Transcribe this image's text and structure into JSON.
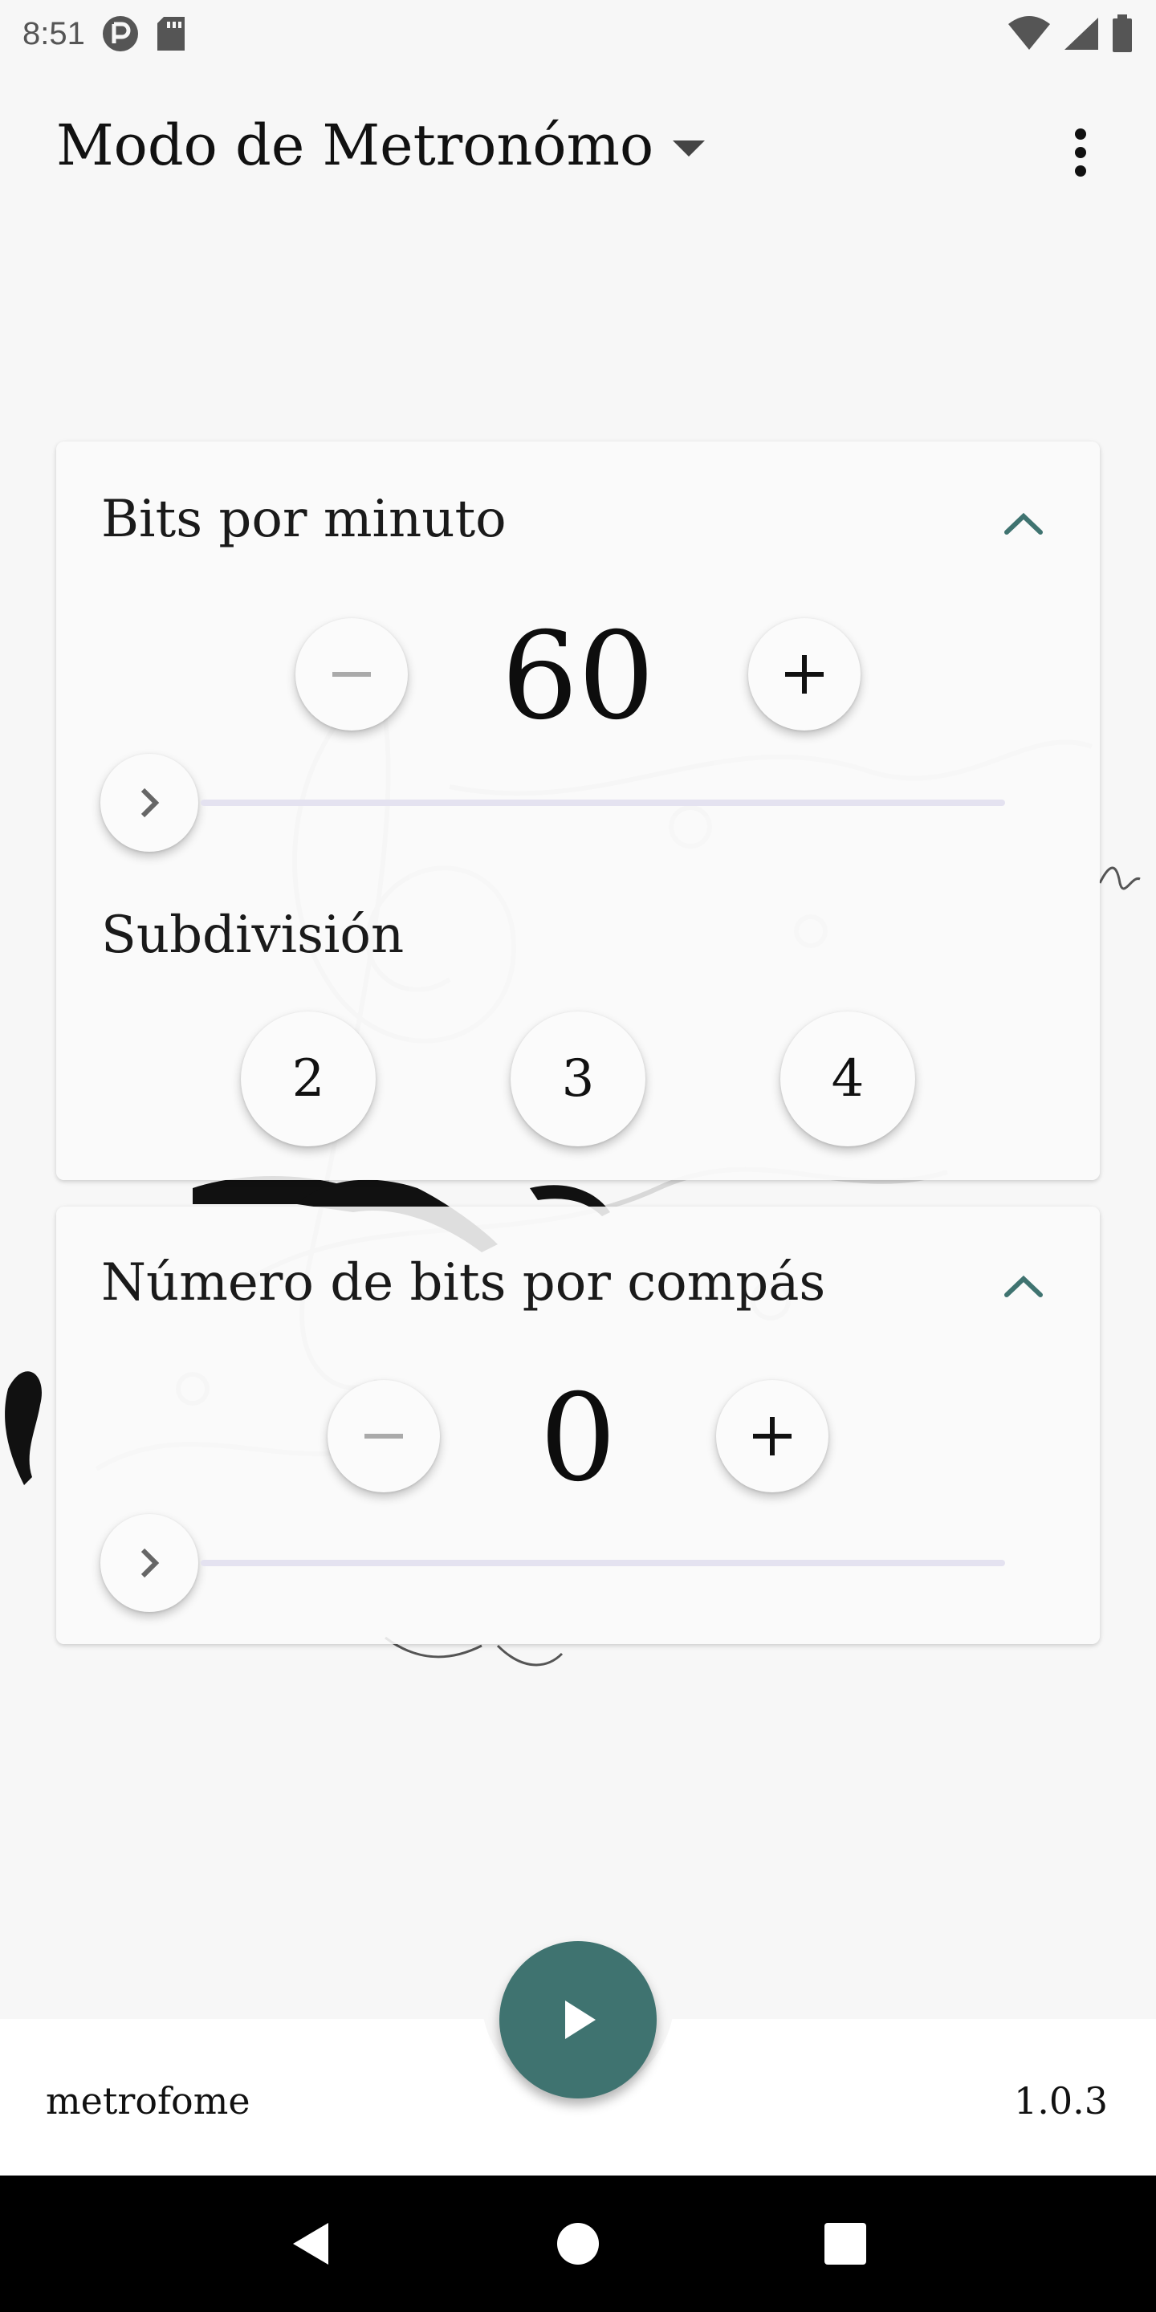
{
  "status_bar": {
    "time": "8:51",
    "icons": [
      "app-notification-icon",
      "sd-card-icon",
      "wifi-icon",
      "signal-icon",
      "battery-icon"
    ]
  },
  "app_bar": {
    "mode_title": "Modo de Metronómo",
    "icons": [
      "dropdown-arrow-icon",
      "more-vert-icon"
    ]
  },
  "bpm_card": {
    "title": "Bits por minuto",
    "value": "60",
    "decrement_symbol": "−",
    "increment_symbol": "+",
    "subdivision_label": "Subdivisión",
    "subdivisions": [
      "2",
      "3",
      "4"
    ],
    "icons": [
      "chevron-up-icon",
      "chevron-right-icon",
      "minus-icon",
      "plus-icon"
    ]
  },
  "beats_card": {
    "title": "Número de bits por compás",
    "value": "0",
    "icons": [
      "chevron-up-icon",
      "chevron-right-icon",
      "minus-icon",
      "plus-icon"
    ]
  },
  "bottom_bar": {
    "app_name": "metrofome",
    "version": "1.0.3",
    "icons": [
      "play-icon"
    ]
  },
  "nav_bar": {
    "icons": [
      "back-icon",
      "home-icon",
      "recents-icon"
    ]
  },
  "colors": {
    "accent": "#3f7370",
    "background": "#f7f7f7",
    "card": "#fafafa",
    "slider_track": "#e4e2f0"
  }
}
